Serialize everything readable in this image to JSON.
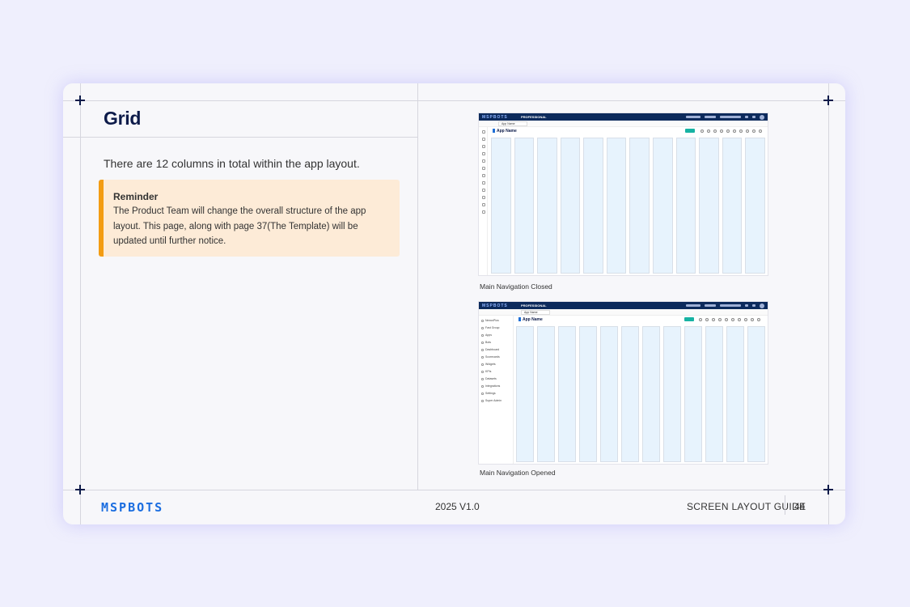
{
  "page": {
    "title": "Grid",
    "description": "There are 12 columns in total within the app layout.",
    "reminder": {
      "title": "Reminder",
      "body": "The Product Team will change the overall structure of the app layout. This page, along with page 37(The Template) will be updated until further notice."
    }
  },
  "mockups": [
    {
      "caption": "Main Navigation Closed",
      "logo": "MSPBOTS",
      "badge": "PROFESSIONAL",
      "app_name": "App Name",
      "tab_label": "App Name",
      "columns": 12
    },
    {
      "caption": "Main Navigation Opened",
      "logo": "MSPBOTS",
      "badge": "PROFESSIONAL",
      "app_name": "App Name",
      "tab_label": "App Name",
      "columns": 12,
      "sidebar_items": [
        "NexusPlus",
        "Fast Group",
        "Apps",
        "Bots",
        "Dashboard",
        "Scorecards",
        "Widgets",
        "KPIs",
        "Datasets",
        "Integrations",
        "Settings",
        "Super Admin"
      ]
    }
  ],
  "footer": {
    "logo": "MSPBOTS",
    "version": "2025 V1.0",
    "guide": "SCREEN LAYOUT GUIDE",
    "page_number": "44"
  },
  "colors": {
    "background": "#efeffd",
    "navy": "#0d1b4a",
    "accent_orange": "#f39c12",
    "reminder_bg": "#fdebd7",
    "brand_blue": "#1a6de0",
    "grid_column": "#e7f3fd",
    "teal_button": "#17b3a3"
  }
}
